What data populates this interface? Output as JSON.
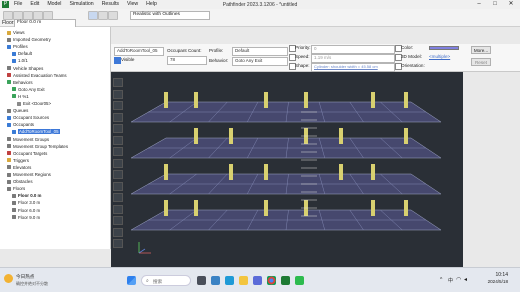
{
  "window": {
    "app_icon": "pathfinder-app-icon",
    "title": "Pathfinder 2023.3.1206 - *untitled",
    "menu": [
      "File",
      "Edit",
      "Model",
      "Simulation",
      "Results",
      "View",
      "Help"
    ],
    "controls": {
      "minimize": "–",
      "maximize": "□",
      "close": "✕"
    }
  },
  "toolbar": {
    "floor_label": "Floor:",
    "floor_value": "Floor 0.0 m",
    "view_mode": "Realistic with Outlines",
    "icon_names": [
      "new-icon",
      "open-icon",
      "save-icon",
      "undo-icon",
      "redo-icon",
      "perspective-icon",
      "render-icon",
      "grid-icon"
    ]
  },
  "tree": {
    "items": [
      {
        "label": "Views",
        "icon": "folder-icon",
        "color": "#d9a93c"
      },
      {
        "label": "Imported Geometry",
        "icon": "geometry-icon",
        "color": "#7a7a7a"
      },
      {
        "label": "Profiles",
        "icon": "profile-icon",
        "color": "#3a7bd5"
      },
      {
        "label": "Default",
        "icon": "person-icon",
        "color": "#3a7bd5"
      },
      {
        "label": "1.0/1",
        "icon": "person-icon",
        "color": "#3a7bd5"
      },
      {
        "label": "Vehicle Shapes",
        "icon": "vehicle-icon",
        "color": "#7a7a7a"
      },
      {
        "label": "Assisted Evacuation Teams",
        "icon": "team-icon",
        "color": "#c04040"
      },
      {
        "label": "Behaviors",
        "icon": "behavior-icon",
        "color": "#3aa35a"
      },
      {
        "label": "Goto Any Exit",
        "icon": "behavior-icon",
        "color": "#3aa35a"
      },
      {
        "label": "H %1",
        "icon": "behavior-icon",
        "color": "#3aa35a"
      },
      {
        "label": "Exit <Door05>",
        "icon": "door-icon",
        "color": "#8a8a8a"
      },
      {
        "label": "Queues",
        "icon": "queue-icon",
        "color": "#7a7a7a"
      },
      {
        "label": "Occupant Sources",
        "icon": "source-icon",
        "color": "#3a7bd5"
      },
      {
        "label": "Occupants",
        "icon": "occupant-icon",
        "color": "#3a7bd5"
      },
      {
        "label": "AddToRoomTool_05",
        "icon": "occupant-icon",
        "color": "#3a7bd5",
        "selected": true
      },
      {
        "label": "Movement Groups",
        "icon": "group-icon",
        "color": "#7a7a7a"
      },
      {
        "label": "Movement Group Templates",
        "icon": "group-icon",
        "color": "#7a7a7a"
      },
      {
        "label": "Occupant Targets",
        "icon": "target-icon",
        "color": "#c04040"
      },
      {
        "label": "Triggers",
        "icon": "trigger-icon",
        "color": "#d9a93c"
      },
      {
        "label": "Elevators",
        "icon": "elevator-icon",
        "color": "#7a7a7a"
      },
      {
        "label": "Movement Regions",
        "icon": "region-icon",
        "color": "#7a7a7a"
      },
      {
        "label": "Obstacles",
        "icon": "obstacle-icon",
        "color": "#7a7a7a"
      },
      {
        "label": "Floors",
        "icon": "floor-icon",
        "color": "#7a7a7a"
      },
      {
        "label": "Floor 0.0 m",
        "icon": "floor-icon",
        "color": "#7a7a7a",
        "bold": true
      },
      {
        "label": "Floor 3.0 m",
        "icon": "floor-icon",
        "color": "#7a7a7a"
      },
      {
        "label": "Floor 6.0 m",
        "icon": "floor-icon",
        "color": "#7a7a7a"
      },
      {
        "label": "Floor 9.0 m",
        "icon": "floor-icon",
        "color": "#7a7a7a"
      }
    ]
  },
  "props": {
    "name_value": "AddToRoomTool_05",
    "visible_label": "Visible",
    "occupant_count_label": "Occupant Count:",
    "occupant_count_value": "78",
    "profile_label": "Profile:",
    "profile_value": "Default",
    "behavior_label": "Behavior:",
    "behavior_value": "Goto Any Exit",
    "priority_label": "Priority:",
    "priority_value": "0",
    "speed_label": "Speed:",
    "speed_value": "1.19 m/s",
    "shape_label": "Shape:",
    "shape_value": "Cylinder: shoulder width = 45.58 cm",
    "color_label": "Color:",
    "color_value": "#8080e0",
    "model3d_label": "3D Model:",
    "model3d_value": "<multiple>",
    "orientation_label": "Orientation:",
    "more_label": "More...",
    "reset_label": "Reset"
  },
  "viewport": {
    "tool_icons": [
      "select-icon",
      "room-icon",
      "wall-icon",
      "door-icon",
      "stair-icon",
      "ramp-icon",
      "escalator-icon",
      "elevator-icon",
      "obstacle-icon",
      "occupant-icon",
      "region-icon",
      "target-icon",
      "measure-icon",
      "grid-icon",
      "delete-icon"
    ],
    "floors": 4,
    "colors": {
      "background": "#2a2f36",
      "floor": "#4b4c78",
      "pillar": "#d8d070"
    }
  },
  "taskbar": {
    "weather_temp": "19°C",
    "weather_text": "今日热点",
    "weather_sub": "确控并绝对不分散",
    "search_placeholder": "搜索",
    "tray_lang": "中",
    "tray_wifi": "wifi-icon",
    "time": "10:14",
    "date": "2024/5/18",
    "app_icons": [
      "windows-start-icon",
      "task-view-icon",
      "widgets-icon",
      "edge-icon",
      "explorer-icon",
      "store-icon",
      "chrome-icon",
      "pathfinder-taskbar-icon",
      "wechat-icon"
    ]
  }
}
